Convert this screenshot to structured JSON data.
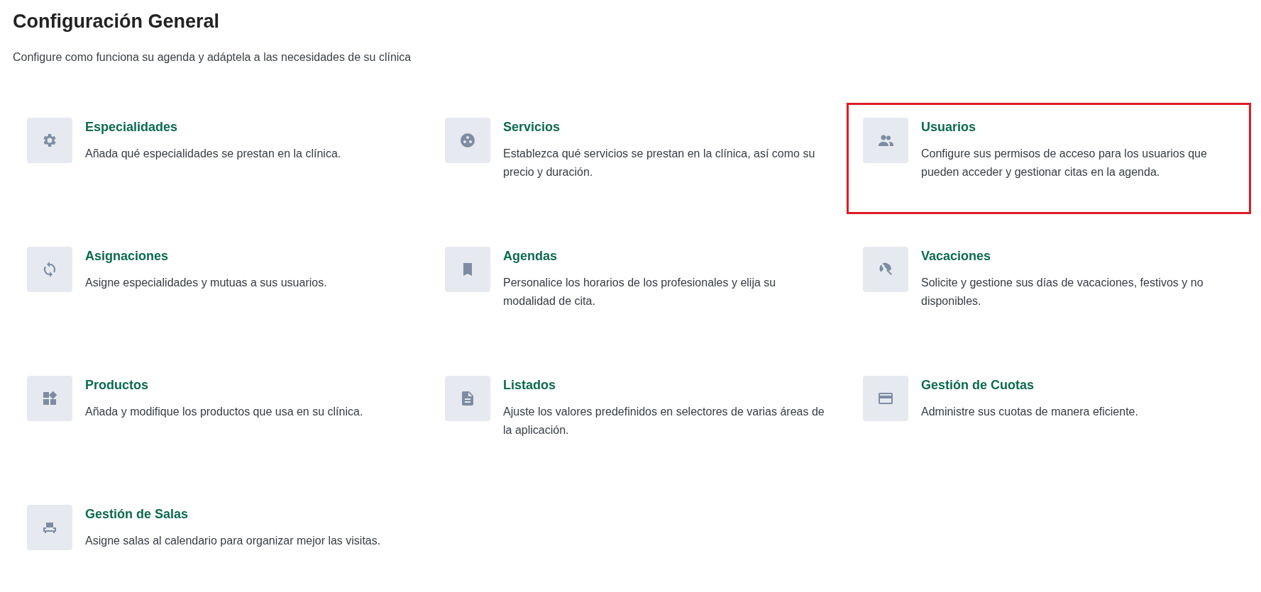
{
  "page": {
    "title": "Configuración General",
    "subtitle": "Configure como funciona su agenda y adáptela a las necesidades de su clínica"
  },
  "sections": [
    {
      "kind": "gear",
      "title": "Especialidades",
      "description": "Añada qué especialidades se prestan en la clínica.",
      "highlighted": false
    },
    {
      "kind": "dots",
      "title": "Servicios",
      "description": "Establezca qué servicios se prestan en la clínica, así como su precio y duración.",
      "highlighted": false
    },
    {
      "kind": "people",
      "title": "Usuarios",
      "description": "Configure sus permisos de acceso para los usuarios que pueden acceder y gestionar citas en la agenda.",
      "highlighted": true
    },
    {
      "kind": "sync",
      "title": "Asignaciones",
      "description": "Asigne especialidades y mutuas a sus usuarios.",
      "highlighted": false
    },
    {
      "kind": "bookmark",
      "title": "Agendas",
      "description": "Personalice los horarios de los profesionales y elija su modalidad de cita.",
      "highlighted": false
    },
    {
      "kind": "umbrella",
      "title": "Vacaciones",
      "description": "Solicite y gestione sus días de vacaciones, festivos y no disponibles.",
      "highlighted": false
    },
    {
      "kind": "widgets",
      "title": "Productos",
      "description": "Añada y modifique los productos que usa en su clínica.",
      "highlighted": false
    },
    {
      "kind": "document",
      "title": "Listados",
      "description": "Ajuste los valores predefinidos en selectores de varias áreas de la aplicación.",
      "highlighted": false
    },
    {
      "kind": "card",
      "title": "Gestión de Cuotas",
      "description": "Administre sus cuotas de manera eficiente.",
      "highlighted": false
    },
    {
      "kind": "chair",
      "title": "Gestión de Salas",
      "description": "Asigne salas al calendario para organizar mejor las visitas.",
      "highlighted": false
    }
  ]
}
